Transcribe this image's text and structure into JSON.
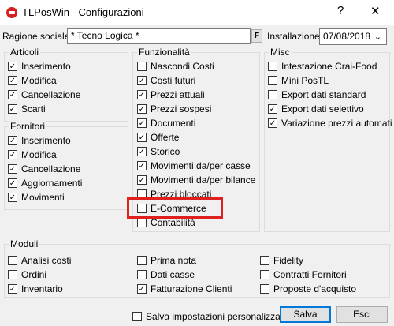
{
  "window": {
    "title": "TLPosWin - Configurazioni",
    "help": "?",
    "close": "✕"
  },
  "header": {
    "ragione_label": "Ragione sociale",
    "ragione_value": "* Tecno Logica *",
    "f_button": "F",
    "installazione_label": "Installazione",
    "installazione_value": "07/08/2018"
  },
  "articoli": {
    "title": "Articoli",
    "items": [
      {
        "label": "Inserimento",
        "checked": true
      },
      {
        "label": "Modifica",
        "checked": true
      },
      {
        "label": "Cancellazione",
        "checked": true
      },
      {
        "label": "Scarti",
        "checked": true
      }
    ]
  },
  "fornitori": {
    "title": "Fornitori",
    "items": [
      {
        "label": "Inserimento",
        "checked": true
      },
      {
        "label": "Modifica",
        "checked": true
      },
      {
        "label": "Cancellazione",
        "checked": true
      },
      {
        "label": "Aggiornamenti",
        "checked": true
      },
      {
        "label": "Movimenti",
        "checked": true
      }
    ]
  },
  "funzionalita": {
    "title": "Funzionalità",
    "items": [
      {
        "label": "Nascondi Costi",
        "checked": false
      },
      {
        "label": "Costi futuri",
        "checked": true
      },
      {
        "label": "Prezzi attuali",
        "checked": true
      },
      {
        "label": "Prezzi sospesi",
        "checked": true
      },
      {
        "label": "Documenti",
        "checked": true
      },
      {
        "label": "Offerte",
        "checked": true
      },
      {
        "label": "Storico",
        "checked": true
      },
      {
        "label": "Movimenti da/per casse",
        "checked": true
      },
      {
        "label": "Movimenti da/per bilance",
        "checked": true
      },
      {
        "label": "Prezzi bloccati",
        "checked": false
      },
      {
        "label": "E-Commerce",
        "checked": false
      },
      {
        "label": "Contabilità",
        "checked": false
      }
    ]
  },
  "misc": {
    "title": "Misc",
    "items": [
      {
        "label": "Intestazione Crai-Food",
        "checked": false
      },
      {
        "label": "Mini PosTL",
        "checked": false
      },
      {
        "label": "Export dati standard",
        "checked": false
      },
      {
        "label": "Export dati selettivo",
        "checked": true
      },
      {
        "label": "Variazione prezzi automati",
        "checked": true
      }
    ]
  },
  "moduli": {
    "title": "Moduli",
    "col1": [
      {
        "label": "Analisi costi",
        "checked": false
      },
      {
        "label": "Ordini",
        "checked": false
      },
      {
        "label": "Inventario",
        "checked": true
      }
    ],
    "col2": [
      {
        "label": "Prima nota",
        "checked": false
      },
      {
        "label": "Dati casse",
        "checked": false
      },
      {
        "label": "Fatturazione Clienti",
        "checked": true
      }
    ],
    "col3": [
      {
        "label": "Fidelity",
        "checked": false
      },
      {
        "label": "Contratti Fornitori",
        "checked": false
      },
      {
        "label": "Proposte d'acquisto",
        "checked": false
      }
    ]
  },
  "footer": {
    "salva_impostazioni": "Salva impostazioni personalizzate",
    "salva_checked": false,
    "salva": "Salva",
    "esci": "Esci"
  },
  "colors": {
    "highlight": "#e02020",
    "default_button_border": "#0078d7"
  }
}
